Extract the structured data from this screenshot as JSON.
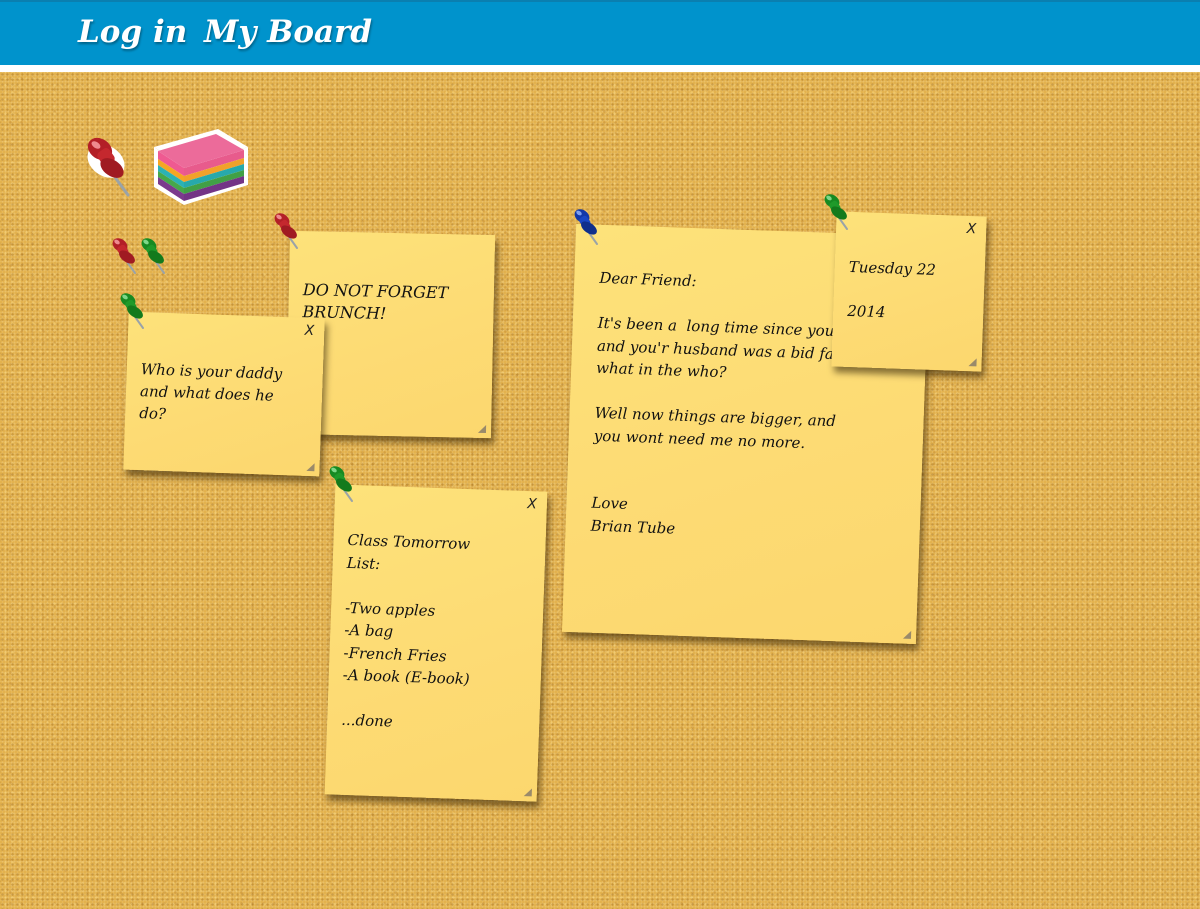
{
  "nav": {
    "login_label": "Log in",
    "board_label": "My Board"
  },
  "colors": {
    "topbar": "#0093cc",
    "cork": "#e2b04c",
    "note": "#fddb74",
    "pin_red": "#c4282e",
    "pin_green": "#1f9a2a",
    "pin_blue": "#1846c4"
  },
  "tray": {
    "pin_icon": "red-push-pin-icon",
    "stack_icon": "sticky-note-stack-icon",
    "loose_pins": [
      "red-push-pin-icon",
      "green-push-pin-icon"
    ]
  },
  "notes": [
    {
      "id": "brunch",
      "text": "DO NOT FORGET\nBRUNCH!",
      "pin_color": "red",
      "has_close": false
    },
    {
      "id": "daddy",
      "text": "Who is your daddy\nand what does he\ndo?",
      "pin_color": "green",
      "close_label": "X"
    },
    {
      "id": "class",
      "text": "Class Tomorrow\nList:\n\n-Two apples\n-A bag\n-French Fries\n-A book (E-book)\n\n...done",
      "pin_color": "green",
      "close_label": "X"
    },
    {
      "id": "friend",
      "text": "Dear Friend:\n\nIt's been a  long time since you\nand you'r husband was a bid fa\nwhat in the who?\n\nWell now things are bigger, and\nyou wont need me no more.\n\n\nLove\nBrian Tube",
      "pin_color": "blue",
      "has_close": false
    },
    {
      "id": "date",
      "text": "Tuesday 22\n\n2014",
      "pin_color": "green",
      "close_label": "X"
    }
  ]
}
